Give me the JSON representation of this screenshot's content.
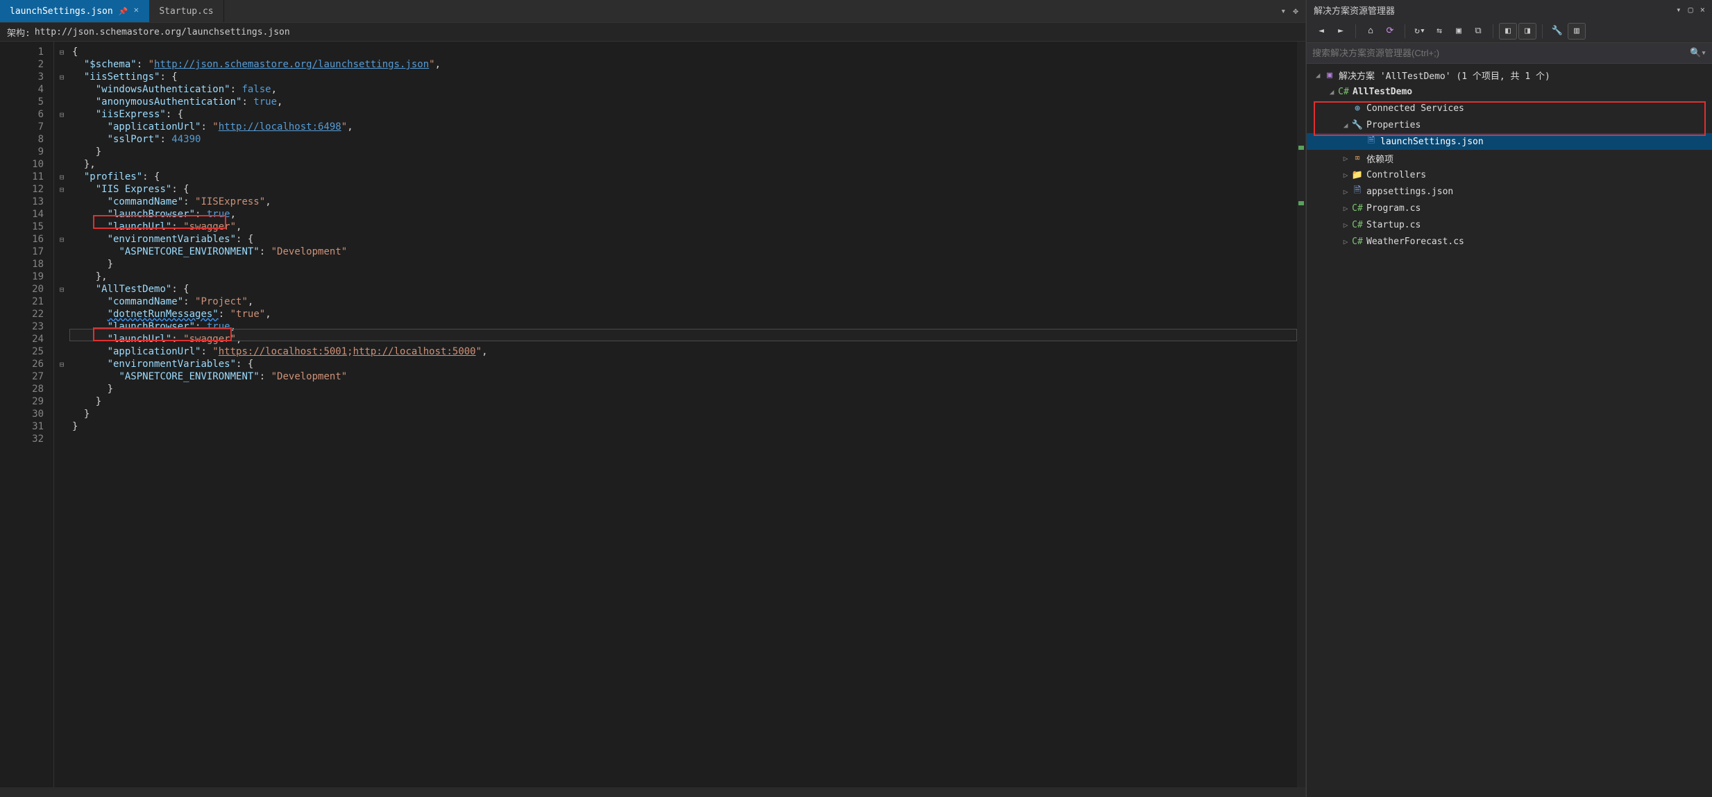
{
  "tabs": {
    "items": [
      {
        "label": "launchSettings.json",
        "pinned": true,
        "active": true
      },
      {
        "label": "Startup.cs",
        "pinned": false,
        "active": false
      }
    ]
  },
  "schema_bar": {
    "label": "架构:",
    "url": "http://json.schemastore.org/launchsettings.json"
  },
  "line_numbers": [
    "1",
    "2",
    "3",
    "4",
    "5",
    "6",
    "7",
    "8",
    "9",
    "10",
    "11",
    "12",
    "13",
    "14",
    "15",
    "16",
    "17",
    "18",
    "19",
    "20",
    "21",
    "22",
    "23",
    "24",
    "25",
    "26",
    "27",
    "28",
    "29",
    "30",
    "31",
    "32"
  ],
  "file": {
    "schema_url": "http://json.schemastore.org/launchsettings.json",
    "iisSettings": {
      "windowsAuthentication": "false",
      "anonymousAuthentication": "true",
      "iisExpress": {
        "applicationUrl": "http://localhost:6498",
        "sslPort": "44390"
      }
    },
    "profiles": {
      "iis_express": {
        "name": "IIS Express",
        "commandName": "IISExpress",
        "launchBrowser": "true",
        "launchUrl": "swagger",
        "env_aspnetcore": "Development"
      },
      "project": {
        "name": "AllTestDemo",
        "commandName": "Project",
        "dotnetRunMessages": "true",
        "launchBrowser": "true",
        "launchUrl": "swagger",
        "applicationUrl_https": "https://localhost:5001",
        "applicationUrl_http": "http://localhost:5000",
        "env_aspnetcore": "Development"
      }
    }
  },
  "solexp": {
    "title": "解决方案资源管理器",
    "search_placeholder": "搜索解决方案资源管理器(Ctrl+;)",
    "solution_line": "解决方案 'AllTestDemo' (1 个项目, 共 1 个)",
    "project": "AllTestDemo",
    "nodes": {
      "connected": "Connected Services",
      "properties": "Properties",
      "launchSettings": "launchSettings.json",
      "deps": "依赖项",
      "controllers": "Controllers",
      "appsettings": "appsettings.json",
      "program": "Program.cs",
      "startup": "Startup.cs",
      "weather": "WeatherForecast.cs"
    }
  }
}
